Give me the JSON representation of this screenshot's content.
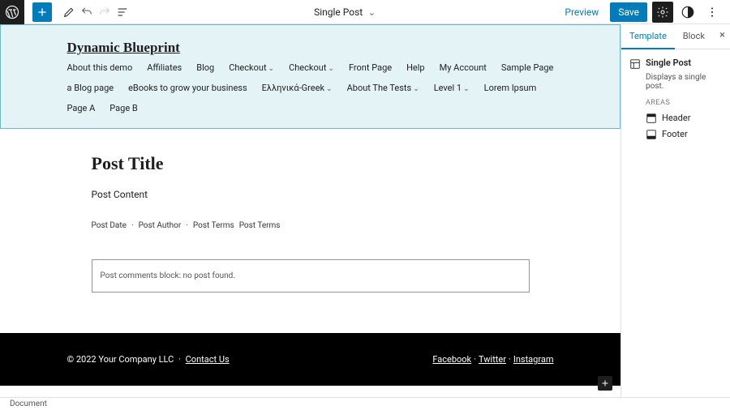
{
  "toolbar": {
    "template_name": "Single Post",
    "preview": "Preview",
    "save": "Save"
  },
  "header": {
    "site_title": "Dynamic Blueprint",
    "nav": [
      "About this demo",
      "Affiliates",
      "Blog",
      "Checkout",
      "Checkout",
      "Front Page",
      "Help",
      "My Account",
      "Sample Page",
      "a Blog page",
      "eBooks to grow your business",
      "Ελληνικά-Greek",
      "About The Tests",
      "Level 1",
      "Lorem Ipsum",
      "Page A",
      "Page B"
    ],
    "nav_has_sub": [
      false,
      false,
      false,
      true,
      true,
      false,
      false,
      false,
      false,
      false,
      false,
      true,
      true,
      true,
      false,
      false,
      false
    ]
  },
  "content": {
    "post_title": "Post Title",
    "post_content": "Post Content",
    "meta": [
      "Post Date",
      "Post Author",
      "Post Terms",
      "Post Terms"
    ],
    "comments": "Post comments block: no post found."
  },
  "footer": {
    "copyright": "© 2022 Your Company LLC",
    "contact": "Contact Us",
    "social": [
      "Facebook",
      "Twitter",
      "Instagram"
    ]
  },
  "sidebar": {
    "tabs": [
      "Template",
      "Block"
    ],
    "template_title": "Single Post",
    "template_desc": "Displays a single post.",
    "areas_label": "AREAS",
    "areas": [
      "Header",
      "Footer"
    ]
  },
  "status": {
    "breadcrumb": "Document"
  }
}
